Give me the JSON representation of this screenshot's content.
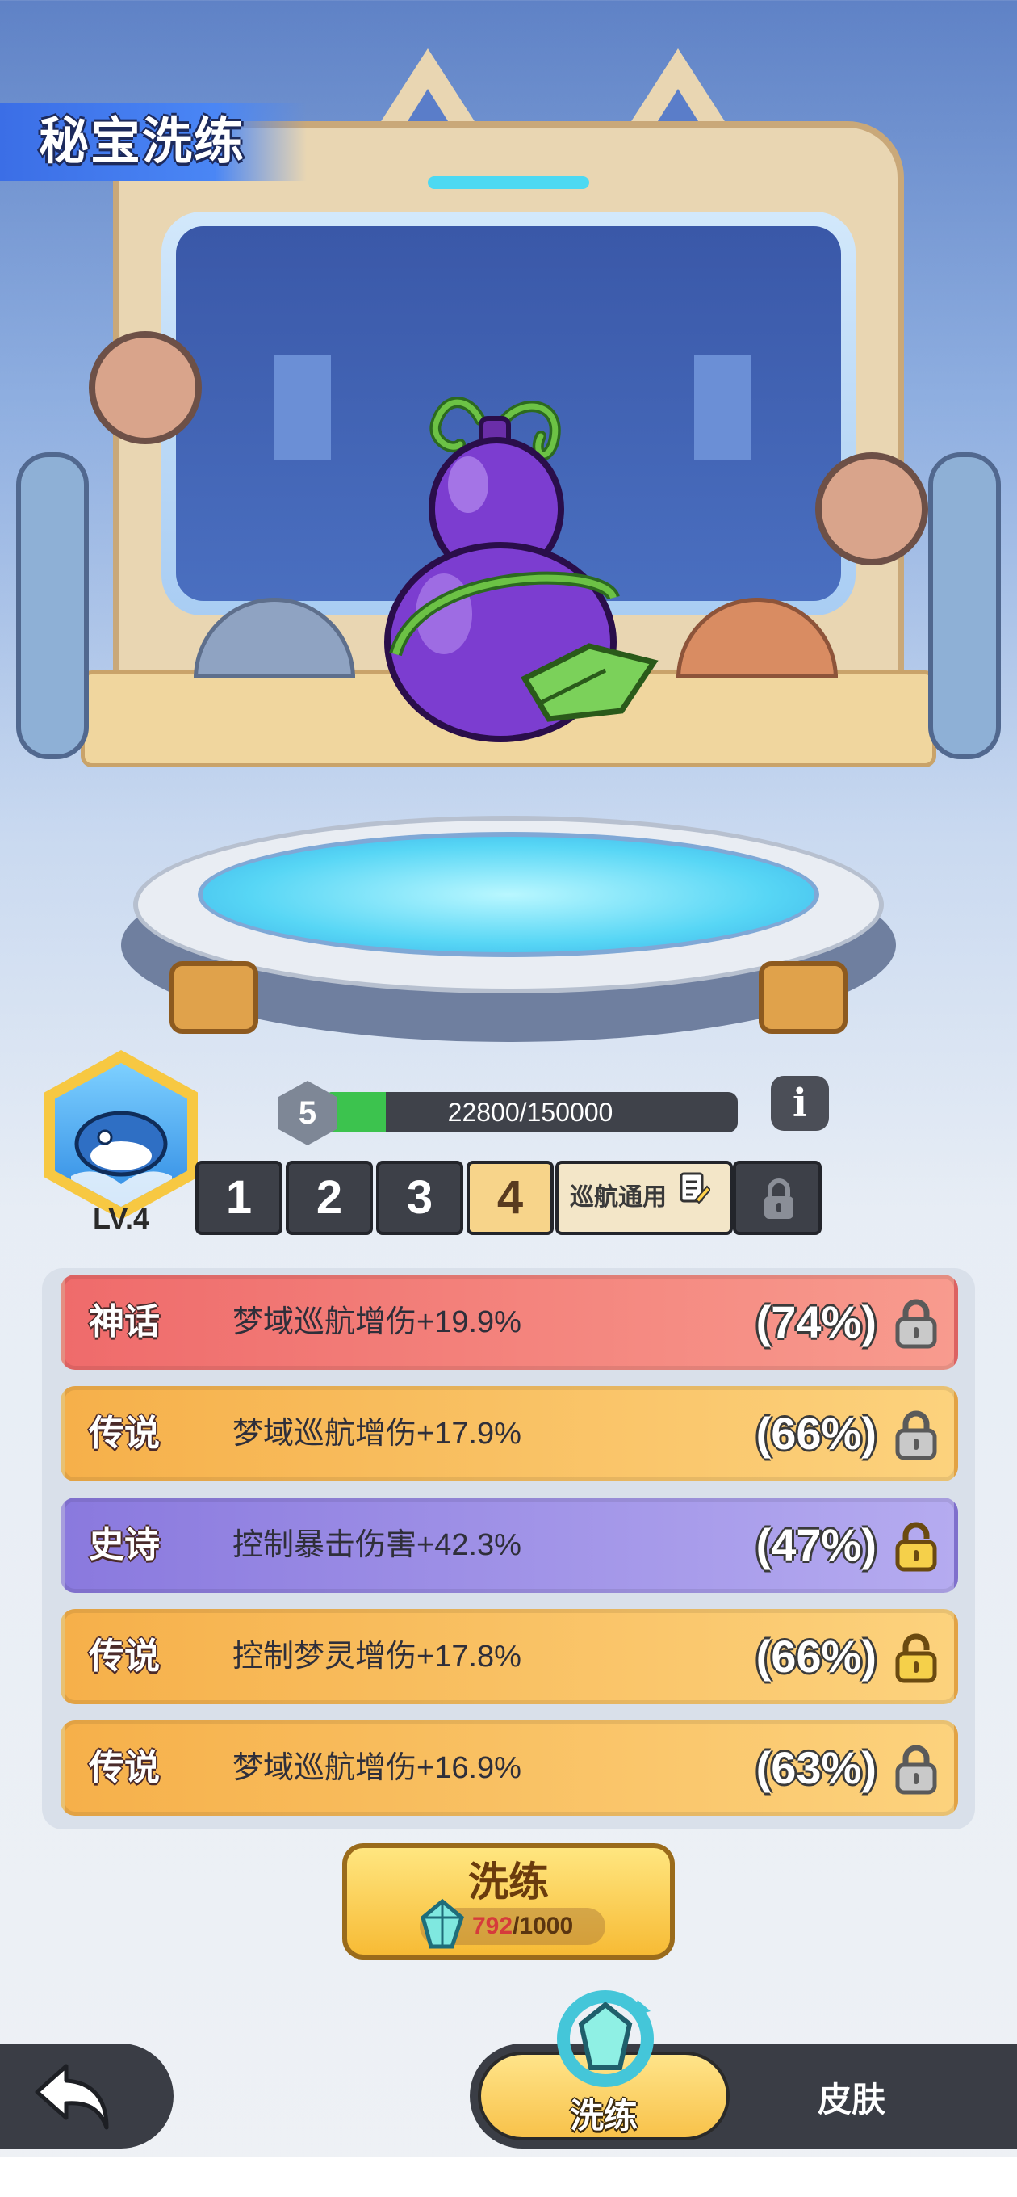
{
  "header": {
    "title": "秘宝洗练"
  },
  "treasure": {
    "icon": "purple-gourd-icon"
  },
  "avatar": {
    "level_label": "LV.4"
  },
  "progress": {
    "level": "5",
    "current": 22800,
    "max": 150000,
    "text": "22800/150000"
  },
  "slot_tabs": [
    {
      "label": "1",
      "active": false
    },
    {
      "label": "2",
      "active": false
    },
    {
      "label": "3",
      "active": false
    },
    {
      "label": "4",
      "active": true
    }
  ],
  "general_tab": {
    "label": "巡航通用"
  },
  "attributes": [
    {
      "rarity": "神话",
      "text": "梦域巡航增伤+19.9%",
      "percent": "(74%)",
      "locked": true,
      "style": "myth"
    },
    {
      "rarity": "传说",
      "text": "梦域巡航增伤+17.9%",
      "percent": "(66%)",
      "locked": true,
      "style": "leg"
    },
    {
      "rarity": "史诗",
      "text": "控制暴击伤害+42.3%",
      "percent": "(47%)",
      "locked": false,
      "style": "epic"
    },
    {
      "rarity": "传说",
      "text": "控制梦灵增伤+17.8%",
      "percent": "(66%)",
      "locked": false,
      "style": "leg"
    },
    {
      "rarity": "传说",
      "text": "梦域巡航增伤+16.9%",
      "percent": "(63%)",
      "locked": true,
      "style": "leg"
    }
  ],
  "refine": {
    "label": "洗练",
    "cost_current": "792",
    "cost_max": "/1000"
  },
  "nav": {
    "refine_label": "洗练",
    "skin_label": "皮肤"
  },
  "colors": {
    "accent": "#f7c842",
    "exp_fill": "#3cc34e",
    "myth": "#ef6b6b",
    "legend": "#f6b04a",
    "epic": "#8a79de"
  }
}
